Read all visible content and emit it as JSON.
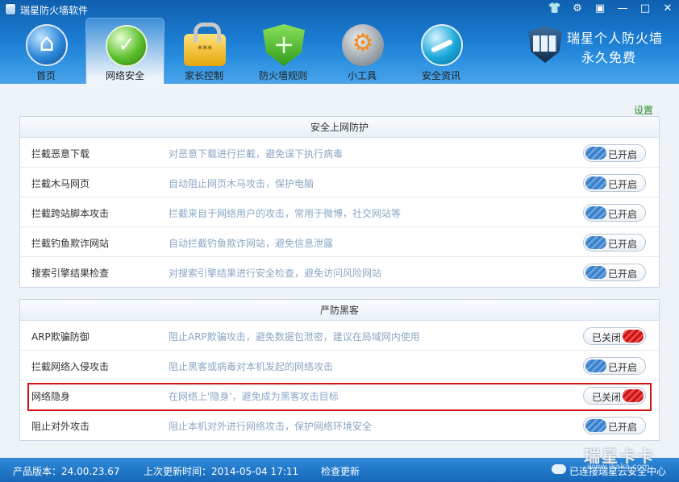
{
  "window": {
    "title": "瑞星防火墙软件",
    "buttons": [
      "shirt-icon",
      "gear-icon",
      "menu-icon",
      "minimize-icon",
      "maximize-icon",
      "close-icon"
    ]
  },
  "brand": {
    "line1": "瑞星个人防火墙",
    "line2": "永久免费"
  },
  "nav": [
    {
      "label": "首页",
      "icon": "home-icon"
    },
    {
      "label": "网络安全",
      "icon": "network-security-icon",
      "active": true
    },
    {
      "label": "家长控制",
      "icon": "lock-icon"
    },
    {
      "label": "防火墙规则",
      "icon": "shield-icon"
    },
    {
      "label": "小工具",
      "icon": "toolbox-icon"
    },
    {
      "label": "安全资讯",
      "icon": "globe-icon"
    }
  ],
  "settings_link": "设置",
  "sections": [
    {
      "title": "安全上网防护",
      "rows": [
        {
          "name": "拦截恶意下载",
          "desc": "对恶意下载进行拦截，避免误下执行病毒",
          "status": "已开启"
        },
        {
          "name": "拦截木马网页",
          "desc": "自动阻止网页木马攻击，保护电脑",
          "status": "已开启"
        },
        {
          "name": "拦截跨站脚本攻击",
          "desc": "拦截来自于网络用户的攻击，常用于微博，社交网站等",
          "status": "已开启"
        },
        {
          "name": "拦截钓鱼欺诈网站",
          "desc": "自动拦截钓鱼欺诈网站，避免信息泄露",
          "status": "已开启"
        },
        {
          "name": "搜索引擎结果检查",
          "desc": "对搜索引擎结果进行安全检查，避免访问风险网站",
          "status": "已开启"
        }
      ]
    },
    {
      "title": "严防黑客",
      "rows": [
        {
          "name": "ARP欺骗防御",
          "desc": "阻止ARP欺骗攻击，避免数据包泄密，建议在局域网内使用",
          "status": "已关闭"
        },
        {
          "name": "拦截网络入侵攻击",
          "desc": "阻止黑客或病毒对本机发起的网络攻击",
          "status": "已开启"
        },
        {
          "name": "网络隐身",
          "desc": "在网络上'隐身'，避免成为黑客攻击目标",
          "status": "已关闭"
        },
        {
          "name": "阻止对外攻击",
          "desc": "阻止本机对外进行网络攻击，保护网络环境安全",
          "status": "已开启"
        }
      ]
    }
  ],
  "statusbar": {
    "version": "产品版本：24.00.23.67",
    "last_update": "上次更新时间：2014-05-04 17:11",
    "check_update": "检查更新",
    "cloud": "已连接瑞星云安全中心"
  },
  "watermark": {
    "line1": "瑞星卡卡",
    "line2": "www.ikaka.com"
  },
  "colors": {
    "accent": "#1a7bd0",
    "on": "#3a7fc6",
    "off": "#d01414",
    "settings": "#2c8b2c"
  }
}
